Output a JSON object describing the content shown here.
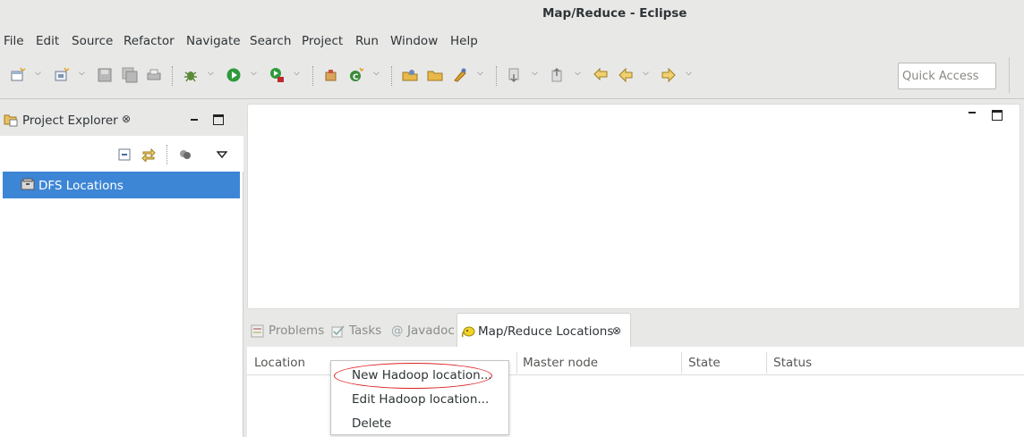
{
  "window": {
    "title": "Map/Reduce - Eclipse"
  },
  "menu": [
    "File",
    "Edit",
    "Source",
    "Refactor",
    "Navigate",
    "Search",
    "Project",
    "Run",
    "Window",
    "Help"
  ],
  "toolbar": {
    "quick_access_placeholder": "Quick Access"
  },
  "project_explorer": {
    "tab_label": "Project Explorer",
    "tree": [
      {
        "label": "DFS Locations",
        "selected": true
      }
    ]
  },
  "bottom_panel": {
    "tabs": [
      {
        "label": "Problems",
        "active": false
      },
      {
        "label": "Tasks",
        "active": false
      },
      {
        "label": "Javadoc",
        "active": false
      },
      {
        "label": "Map/Reduce Locations",
        "active": true
      }
    ],
    "columns": [
      "Location",
      "Master node",
      "State",
      "Status"
    ]
  },
  "context_menu": {
    "items": [
      "New Hadoop location...",
      "Edit Hadoop location...",
      "Delete"
    ],
    "highlighted_item": "New Hadoop location..."
  },
  "colors": {
    "selection": "#3d86d5",
    "highlight_oval": "#dd2222"
  }
}
